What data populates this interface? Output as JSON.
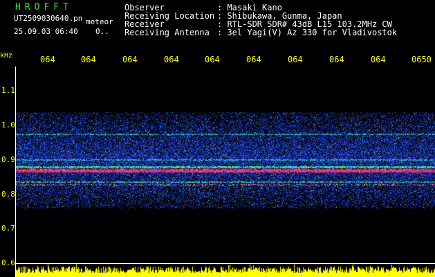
{
  "header": {
    "app_title": "HROFFT",
    "file_name": "UT2509030640.pn",
    "mode": "meteor",
    "date_time": "25.09.03 06:40",
    "marker": "0.."
  },
  "station": {
    "fields": [
      {
        "label": "Observer",
        "value": ": Masaki Kano"
      },
      {
        "label": "Receiving Location",
        "value": ": Shibukawa, Gunma, Japan"
      },
      {
        "label": "Receiver",
        "value": ": RTL-SDR SDR# 43dB L15 103.2MHz CW"
      },
      {
        "label": "Receiving Antenna",
        "value": ": 3el Yagi(V) Az 330 for Vladivostok"
      }
    ]
  },
  "spectrogram": {
    "unit": "kHz",
    "x_ticks": [
      "064",
      "064",
      "064",
      "064",
      "064",
      "064",
      "064",
      "064",
      "064",
      "0650"
    ],
    "y_ticks": [
      "1.1",
      "1.0",
      "0.9",
      "0.8",
      "0.7",
      "0.6"
    ],
    "colors": {
      "background": "#000000",
      "noise": "#1e3cc8",
      "signal_mid": "#2ad2a0",
      "signal_peak": "#ff2080",
      "power_trace": "#ffff00",
      "tick_labels": "#ffff00"
    }
  }
}
